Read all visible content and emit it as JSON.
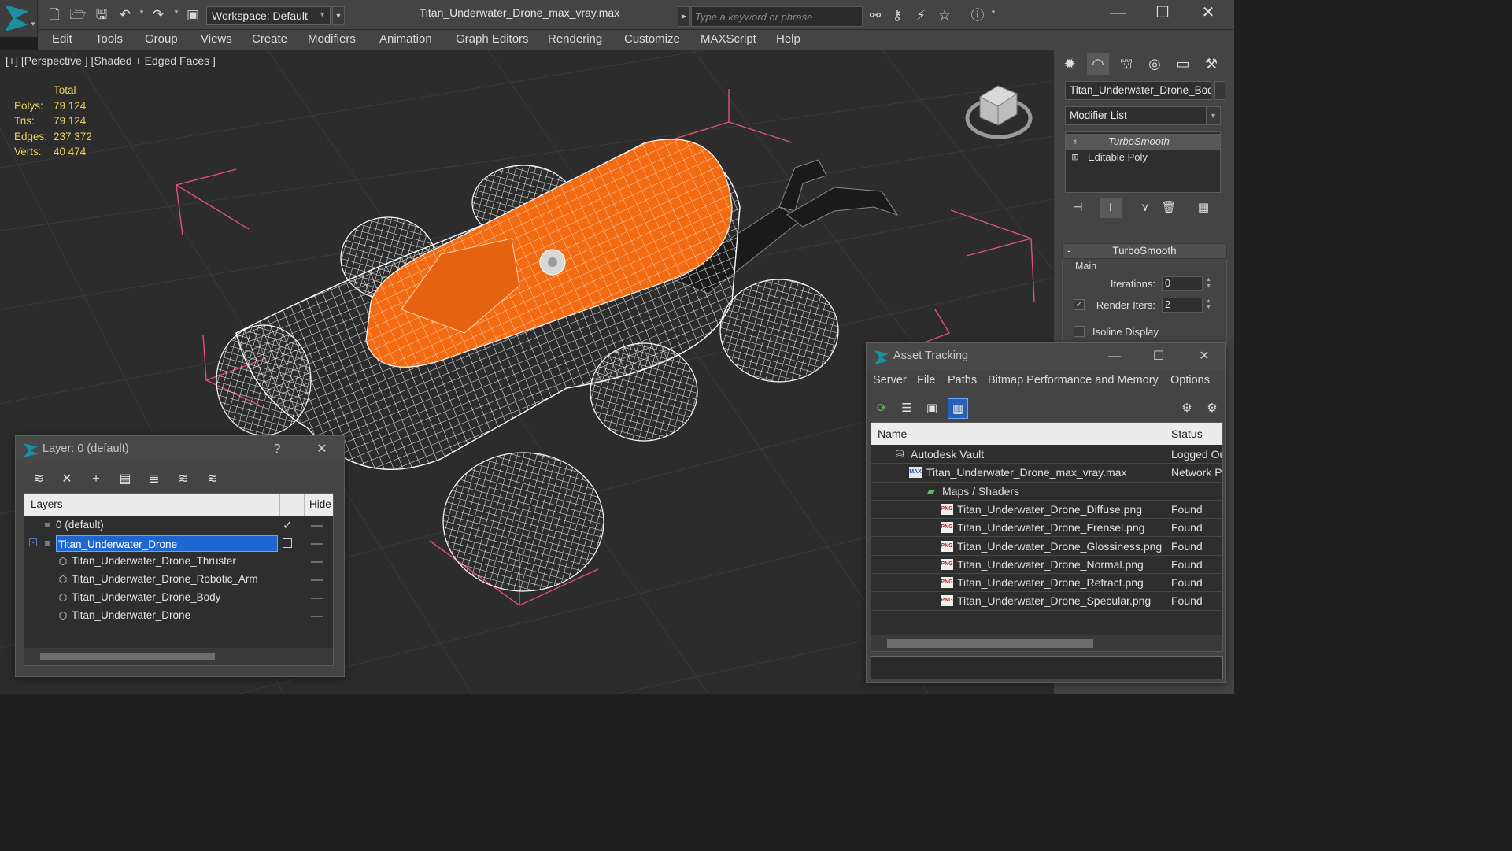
{
  "titlebar": {
    "workspace_label": "Workspace: Default",
    "window_title": "Titan_Underwater_Drone_max_vray.max",
    "search_placeholder": "Type a keyword or phrase"
  },
  "menu": [
    "Edit",
    "Tools",
    "Group",
    "Views",
    "Create",
    "Modifiers",
    "Animation",
    "Graph Editors",
    "Rendering",
    "Customize",
    "MAXScript",
    "Help"
  ],
  "viewport": {
    "label": "[+] [Perspective ] [Shaded + Edged Faces ]",
    "stats_header": "Total",
    "stats": [
      {
        "label": "Polys:",
        "value": "79 124"
      },
      {
        "label": "Tris:",
        "value": "79 124"
      },
      {
        "label": "Edges:",
        "value": "237 372"
      },
      {
        "label": "Verts:",
        "value": "40 474"
      }
    ],
    "colors": {
      "body_shell": "#f26a12",
      "wireframe": "#ffffff",
      "selection_bracket": "#e0517a",
      "grid": "#3a3a3a"
    }
  },
  "command_panel": {
    "object_name": "Titan_Underwater_Drone_Body",
    "modifier_list": "Modifier List",
    "stack": [
      {
        "label": "TurboSmooth",
        "icon": "lightbulb-icon"
      },
      {
        "label": "Editable Poly",
        "icon": "expand-plus-icon"
      }
    ],
    "rollout_title": "TurboSmooth",
    "group_main": "Main",
    "iterations_label": "Iterations:",
    "iterations_value": "0",
    "render_iters_label": "Render Iters:",
    "render_iters_value": "2",
    "render_iters_checked": true,
    "isoline_label": "Isoline Display",
    "isoline_checked": false
  },
  "layer_window": {
    "title": "Layer: 0 (default)",
    "help": "?",
    "columns": [
      "Layers",
      "Hide"
    ],
    "rows": [
      {
        "name": "0 (default)",
        "indent": 1,
        "active": true,
        "selected": false,
        "kind": "layer"
      },
      {
        "name": "Titan_Underwater_Drone",
        "indent": 1,
        "active": false,
        "selected": true,
        "kind": "layer"
      },
      {
        "name": "Titan_Underwater_Drone_Thruster",
        "indent": 2,
        "active": false,
        "selected": false,
        "kind": "object"
      },
      {
        "name": "Titan_Underwater_Drone_Robotic_Arm",
        "indent": 2,
        "active": false,
        "selected": false,
        "kind": "object"
      },
      {
        "name": "Titan_Underwater_Drone_Body",
        "indent": 2,
        "active": false,
        "selected": false,
        "kind": "object"
      },
      {
        "name": "Titan_Underwater_Drone",
        "indent": 2,
        "active": false,
        "selected": false,
        "kind": "object"
      }
    ]
  },
  "asset_window": {
    "title": "Asset Tracking",
    "menu": [
      "Server",
      "File",
      "Paths",
      "Bitmap Performance and Memory",
      "Options"
    ],
    "columns": [
      "Name",
      "Status"
    ],
    "rows": [
      {
        "name": "Autodesk Vault",
        "status": "Logged Ou",
        "indent": 1,
        "icon": "vault"
      },
      {
        "name": "Titan_Underwater_Drone_max_vray.max",
        "status": "Network P",
        "indent": 2,
        "icon": "max"
      },
      {
        "name": "Maps / Shaders",
        "status": "",
        "indent": 3,
        "icon": "maps"
      },
      {
        "name": "Titan_Underwater_Drone_Diffuse.png",
        "status": "Found",
        "indent": 4,
        "icon": "png"
      },
      {
        "name": "Titan_Underwater_Drone_Frensel.png",
        "status": "Found",
        "indent": 4,
        "icon": "png"
      },
      {
        "name": "Titan_Underwater_Drone_Glossiness.png",
        "status": "Found",
        "indent": 4,
        "icon": "png"
      },
      {
        "name": "Titan_Underwater_Drone_Normal.png",
        "status": "Found",
        "indent": 4,
        "icon": "png"
      },
      {
        "name": "Titan_Underwater_Drone_Refract.png",
        "status": "Found",
        "indent": 4,
        "icon": "png"
      },
      {
        "name": "Titan_Underwater_Drone_Specular.png",
        "status": "Found",
        "indent": 4,
        "icon": "png"
      }
    ],
    "icon_labels": {
      "png": "PNG",
      "max": "MAX"
    }
  }
}
